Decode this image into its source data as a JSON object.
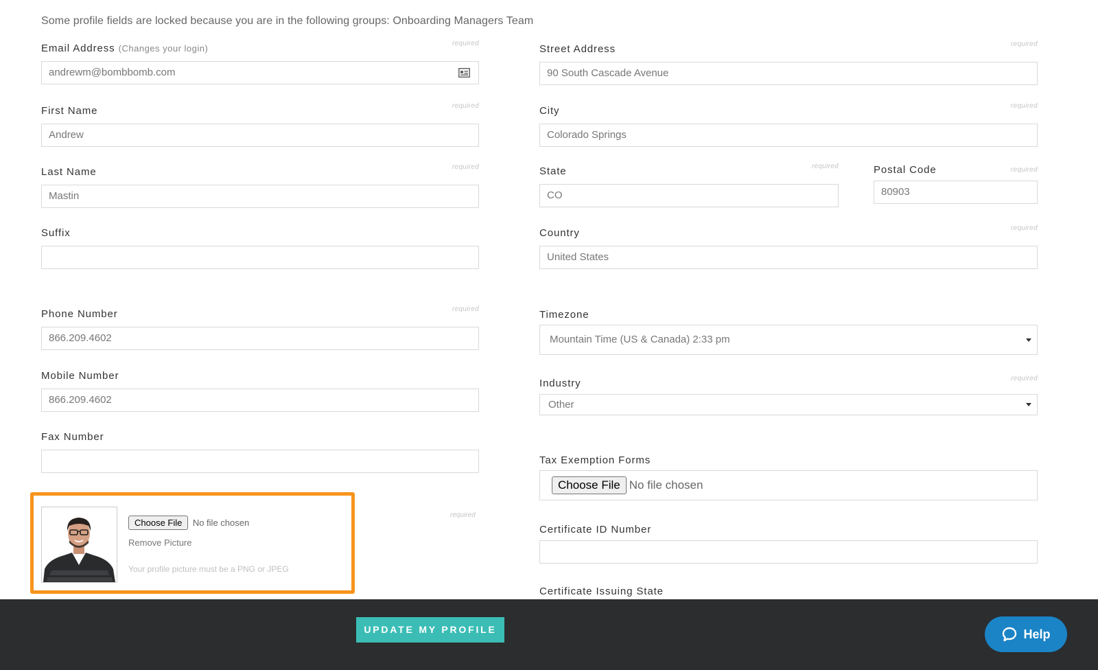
{
  "notice": "Some profile fields are locked because you are in the following groups: Onboarding Managers Team",
  "required_label": "required",
  "left_fields": {
    "email": {
      "label": "Email Address",
      "hint": "(Changes your login)",
      "value": "andrewm@bombbomb.com",
      "icon": "contact-card-icon"
    },
    "first_name": {
      "label": "First Name",
      "value": "Andrew"
    },
    "last_name": {
      "label": "Last Name",
      "value": "Mastin"
    },
    "suffix": {
      "label": "Suffix",
      "value": ""
    },
    "phone": {
      "label": "Phone Number",
      "value": "866.209.4602"
    },
    "mobile": {
      "label": "Mobile Number",
      "value": "866.209.4602"
    },
    "fax": {
      "label": "Fax Number",
      "value": ""
    }
  },
  "right_fields": {
    "street": {
      "label": "Street Address",
      "value": "90 South Cascade Avenue"
    },
    "city": {
      "label": "City",
      "value": "Colorado Springs"
    },
    "state": {
      "label": "State",
      "value": "CO"
    },
    "postal": {
      "label": "Postal Code",
      "value": "80903"
    },
    "country": {
      "label": "Country",
      "value": "United States"
    },
    "timezone": {
      "label": "Timezone",
      "value": "Mountain Time (US & Canada) 2:33 pm"
    },
    "industry": {
      "label": "Industry",
      "value": "Other"
    },
    "tax_forms": {
      "label": "Tax Exemption Forms",
      "button": "Choose File",
      "status": "No file chosen"
    },
    "certificate_id": {
      "label": "Certificate ID Number",
      "value": ""
    },
    "certificate_state": {
      "label": "Certificate Issuing State"
    }
  },
  "profile_picture": {
    "button": "Choose File",
    "status": "No file chosen",
    "remove": "Remove Picture",
    "note": "Your profile picture must be a PNG or JPEG",
    "highlight_color": "#f7941d"
  },
  "footer": {
    "update_button": "UPDATE MY PROFILE",
    "help_button": "Help",
    "bar_color": "#2b2d2f",
    "update_color": "#3bbdb5",
    "help_color": "#1b84c7"
  }
}
